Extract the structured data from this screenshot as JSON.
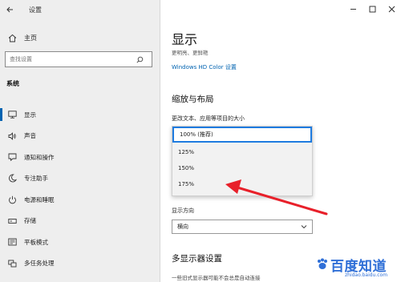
{
  "window": {
    "title": "设置"
  },
  "sidebar": {
    "home_label": "主页",
    "search_placeholder": "查找设置",
    "section_title": "系统",
    "items": [
      {
        "label": "显示",
        "icon": "monitor-icon",
        "active": true
      },
      {
        "label": "声音",
        "icon": "speaker-icon"
      },
      {
        "label": "通知和操作",
        "icon": "notification-icon"
      },
      {
        "label": "专注助手",
        "icon": "moon-icon"
      },
      {
        "label": "电源和睡眠",
        "icon": "power-icon"
      },
      {
        "label": "存储",
        "icon": "storage-icon"
      },
      {
        "label": "平板模式",
        "icon": "tablet-icon"
      },
      {
        "label": "多任务处理",
        "icon": "multitask-icon"
      }
    ]
  },
  "main": {
    "title": "显示",
    "subtext_line1": "更明亮、更鲜艳",
    "subtext_line2": "",
    "hd_link": "Windows HD Color 设置",
    "scale_heading": "缩放与布局",
    "scale_label": "更改文本、应用等项目的大小",
    "scale_options": [
      "100% (推荐)",
      "125%",
      "150%",
      "175%"
    ],
    "scale_selected_index": 0,
    "orientation_label": "显示方向",
    "orientation_value": "横向",
    "multi_heading": "多显示器设置",
    "multi_text": "一些旧式显示器可能不会总是自动连接"
  },
  "watermark": {
    "text": "百度知道",
    "url": "zhidao.baidu.com"
  },
  "colors": {
    "accent": "#0063b1",
    "arrow": "#e8202a",
    "dropdown_highlight": "#1e7be0"
  }
}
